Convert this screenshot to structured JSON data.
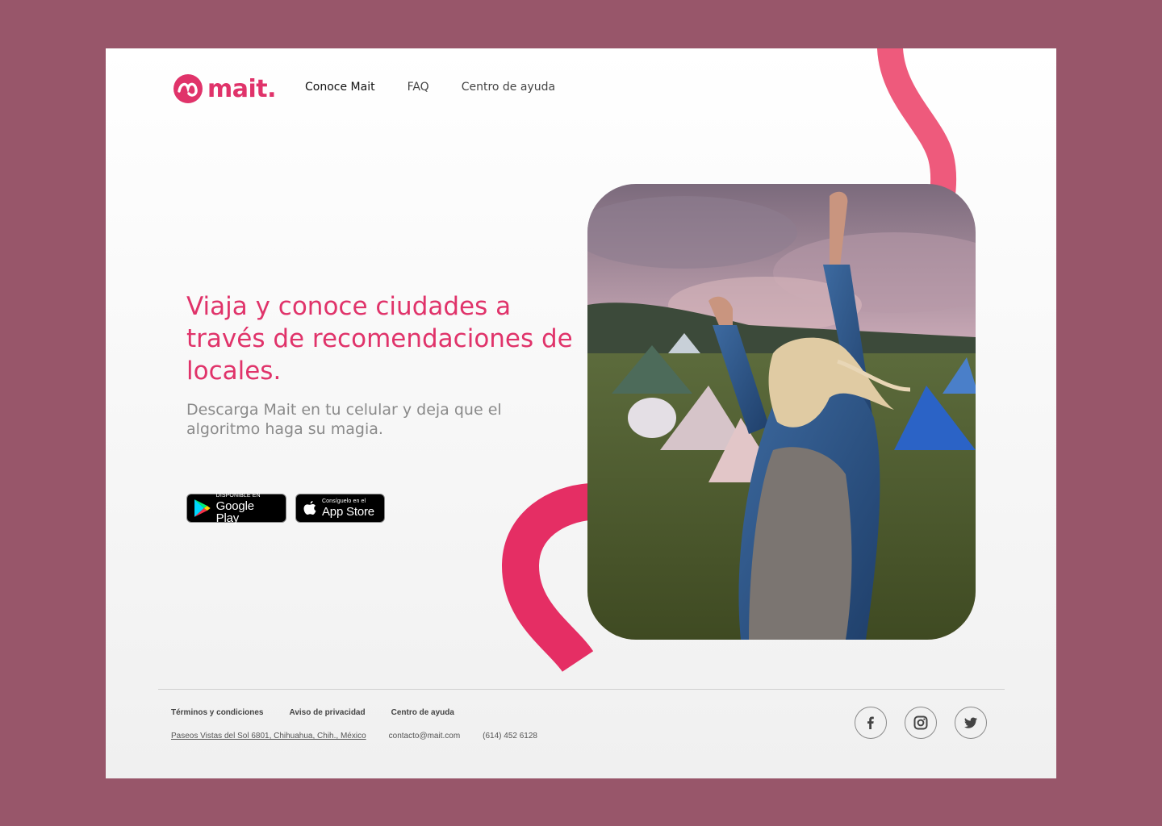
{
  "colors": {
    "brand": "#e0336a",
    "frame": "#98566a",
    "heading": "#e0336a",
    "subtext": "#8a8a8a"
  },
  "header": {
    "logo_icon": "mait-logo-icon",
    "logo_text": "mait.",
    "nav": [
      {
        "label": "Conoce Mait",
        "active": true
      },
      {
        "label": "FAQ"
      },
      {
        "label": "Centro de ayuda"
      }
    ]
  },
  "hero": {
    "title": "Viaja y conoce ciudades a través de recomendaciones de locales.",
    "subtitle": "Descarga Mait en tu celular y deja que el algoritmo haga su magia.",
    "google_play": {
      "small": "DISPONIBLE EN",
      "big": "Google Play",
      "icon": "google-play-icon"
    },
    "app_store": {
      "small": "Consíguelo en el",
      "big": "App Store",
      "icon": "apple-icon"
    },
    "image": "festival-woman-photo"
  },
  "footer": {
    "links": [
      "Términos y condiciones",
      "Aviso de privacidad",
      "Centro de ayuda"
    ],
    "address": "Paseos Vistas del Sol 6801, Chihuahua, Chih., México",
    "email": "contacto@mait.com",
    "phone": "(614) 452 6128",
    "socials": [
      "facebook-icon",
      "instagram-icon",
      "twitter-icon"
    ]
  }
}
